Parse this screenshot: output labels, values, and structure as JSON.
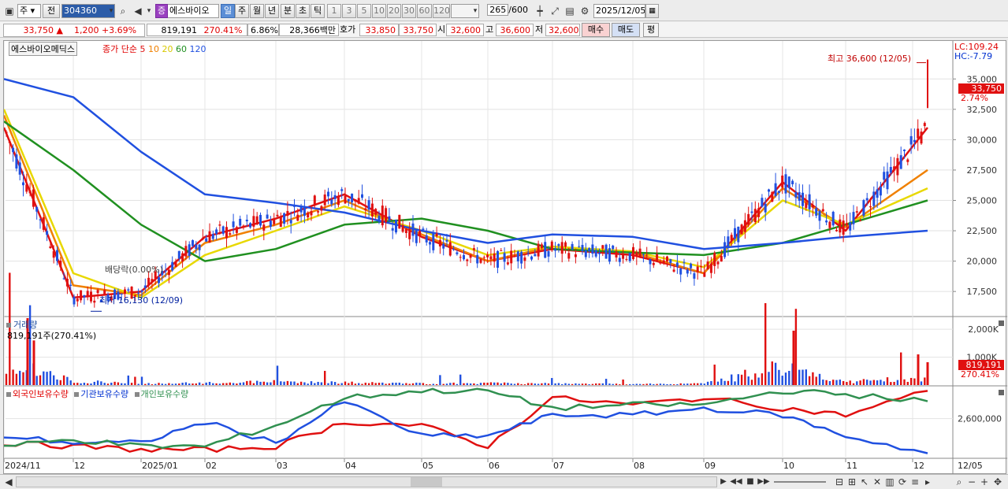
{
  "toolbar": {
    "period_type": "주",
    "prev_label": "전",
    "code": "304360",
    "stock_badge": "증",
    "stock_name": "에스바이오",
    "units": [
      "일",
      "주",
      "월",
      "년",
      "분",
      "초",
      "틱"
    ],
    "selected_unit": "일",
    "intervals": [
      "1",
      "3",
      "5",
      "10",
      "20",
      "30",
      "60",
      "120"
    ],
    "count": "265",
    "count_max": "/600",
    "date": "2025/12/05"
  },
  "quote": {
    "price": "33,750",
    "change": "1,200",
    "change_pct": "+3.69%",
    "volume": "819,191",
    "volume_ratio": "270.41%",
    "turnover": "6.86%",
    "amount": "28,366백만",
    "bid_label": "호가",
    "bid1": "33,850",
    "bid2": "33,750",
    "open_label": "시",
    "open": "32,600",
    "high_label": "고",
    "high": "36,600",
    "low_label": "저",
    "low": "32,600",
    "buy_label": "매수",
    "sell_label": "매도",
    "eval_label": "평"
  },
  "price_panel": {
    "stock_label": "에스바이오메딕스",
    "legend_prefix": "종가 단순",
    "ma_periods": [
      "5",
      "10",
      "20",
      "60",
      "120"
    ],
    "ma_colors": [
      "#e01010",
      "#f08000",
      "#e8d800",
      "#209020",
      "#2050e0"
    ],
    "lc": "LC:109.24",
    "hc": "HC:-7.79",
    "high_annot": "최고 36,600 (12/05)",
    "low_annot": "최저 16,130 (12/09)",
    "dividend_annot": "배당락(0.00%)",
    "last_price": "33,750",
    "last_pct": "2.74%"
  },
  "volume_panel": {
    "title": "거래량",
    "value": "819,191주(270.41%)",
    "axis": "2,000K",
    "axis_mid": "1,000K",
    "last": "819,191",
    "last_pct": "270.41%"
  },
  "holding_panel": {
    "series": [
      "외국인보유수량",
      "기관보유수량",
      "개인보유수량"
    ],
    "series_colors": [
      "#e01010",
      "#2050e0",
      "#309050"
    ],
    "axis": "2,600,000"
  },
  "x_axis": [
    "2024/11",
    "12",
    "2025/01",
    "02",
    "03",
    "04",
    "05",
    "06",
    "07",
    "08",
    "09",
    "10",
    "11",
    "12"
  ],
  "x_right": "12/05",
  "chart_data": [
    {
      "type": "line",
      "title": "에스바이오메딕스",
      "yticks": [
        17500,
        20000,
        22500,
        25000,
        27500,
        30000,
        32500,
        35000
      ],
      "ylim": [
        15500,
        38000
      ],
      "x_range": [
        "2024/11/06",
        "2025/12/05"
      ],
      "x": [
        "2024/11",
        "12",
        "2025/01",
        "02",
        "03",
        "04",
        "05",
        "06",
        "07",
        "08",
        "09",
        "10",
        "11",
        "12/05"
      ],
      "series": [
        {
          "name": "5",
          "values": [
            31000,
            17000,
            17500,
            22000,
            23500,
            25500,
            22000,
            20000,
            21000,
            20500,
            19000,
            26500,
            22500,
            31000
          ]
        },
        {
          "name": "10",
          "values": [
            32000,
            18000,
            17200,
            21500,
            23000,
            25000,
            22200,
            20000,
            21200,
            20700,
            19000,
            26000,
            22800,
            27500
          ]
        },
        {
          "name": "20",
          "values": [
            32500,
            19000,
            17000,
            20500,
            22500,
            24500,
            22500,
            20500,
            21200,
            20800,
            19500,
            25000,
            23000,
            26000
          ]
        },
        {
          "name": "60",
          "values": [
            31500,
            27500,
            23000,
            20000,
            21000,
            23000,
            23500,
            22500,
            21000,
            20700,
            20500,
            21500,
            23000,
            25000
          ]
        },
        {
          "name": "120",
          "values": [
            35000,
            33500,
            29000,
            25500,
            24800,
            24000,
            22500,
            21500,
            22200,
            22000,
            21000,
            21500,
            22000,
            22500
          ]
        }
      ],
      "high": 36600,
      "low": 16130,
      "last": 33750
    },
    {
      "type": "bar",
      "title": "거래량",
      "categories": [
        "2024/11",
        "12",
        "2025/01",
        "02",
        "03",
        "04",
        "05",
        "06",
        "07",
        "08",
        "09",
        "10",
        "11",
        "12/05"
      ],
      "values": [
        2400000,
        450000,
        150000,
        220000,
        380000,
        260000,
        170000,
        210000,
        150000,
        110000,
        160000,
        1950000,
        330000,
        819191
      ],
      "yticks": [
        1000000,
        2000000
      ]
    },
    {
      "type": "line",
      "title": "외국인보유수량 / 기관보유수량 / 개인보유수량",
      "x": [
        "2024/11",
        "12",
        "2025/01",
        "02",
        "03",
        "04",
        "05",
        "06",
        "07",
        "08",
        "09",
        "10",
        "11",
        "12/05"
      ],
      "series": [
        {
          "name": "외국인보유수량",
          "values": [
            0.2,
            0.15,
            0.1,
            0.1,
            0.15,
            0.5,
            0.45,
            0.15,
            0.85,
            0.75,
            0.85,
            0.7,
            0.6,
            0.95
          ]
        },
        {
          "name": "기관보유수량",
          "values": [
            0.3,
            0.2,
            0.2,
            0.5,
            0.2,
            0.8,
            0.3,
            0.3,
            0.6,
            0.6,
            0.7,
            0.6,
            0.3,
            0.05
          ]
        },
        {
          "name": "개인보유수량",
          "values": [
            0.15,
            0.25,
            0.15,
            0.15,
            0.45,
            0.85,
            0.95,
            0.95,
            0.7,
            0.75,
            0.75,
            0.95,
            0.9,
            0.8
          ]
        }
      ],
      "yticks": [
        2600000
      ]
    }
  ]
}
